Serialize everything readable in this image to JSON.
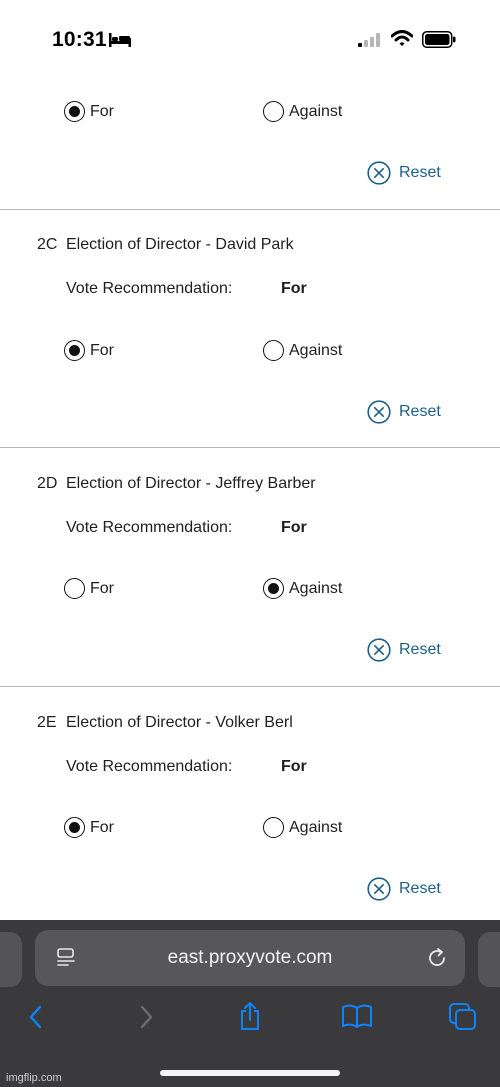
{
  "status_bar": {
    "time": "10:31",
    "icons": [
      "bed-icon",
      "cellular-signal-icon",
      "wifi-icon",
      "battery-icon"
    ]
  },
  "top_partial": {
    "for_label": "For",
    "against_label": "Against",
    "selected": "For",
    "reset_label": "Reset"
  },
  "proposals": [
    {
      "number": "2C",
      "title": "Election of Director - David Park",
      "recommendation_label": "Vote Recommendation:",
      "recommendation": "For",
      "for_label": "For",
      "against_label": "Against",
      "selected": "For",
      "reset_label": "Reset"
    },
    {
      "number": "2D",
      "title": "Election of Director - Jeffrey Barber",
      "recommendation_label": "Vote Recommendation:",
      "recommendation": "For",
      "for_label": "For",
      "against_label": "Against",
      "selected": "Against",
      "reset_label": "Reset"
    },
    {
      "number": "2E",
      "title": "Election of Director - Volker Berl",
      "recommendation_label": "Vote Recommendation:",
      "recommendation": "For",
      "for_label": "For",
      "against_label": "Against",
      "selected": "For",
      "reset_label": "Reset"
    }
  ],
  "browser": {
    "url": "east.proxyvote.com",
    "toolbar_icons": [
      "back-icon",
      "forward-icon",
      "share-icon",
      "bookmarks-icon",
      "tabs-icon"
    ]
  },
  "colors": {
    "accent": "#1d5f8a",
    "browser_bg": "#3a3a3c",
    "url_field_bg": "#57575b",
    "toolbar_icon_active": "#0a84ff",
    "toolbar_icon_disabled": "#6c6c70"
  },
  "watermark": "imgflip.com"
}
